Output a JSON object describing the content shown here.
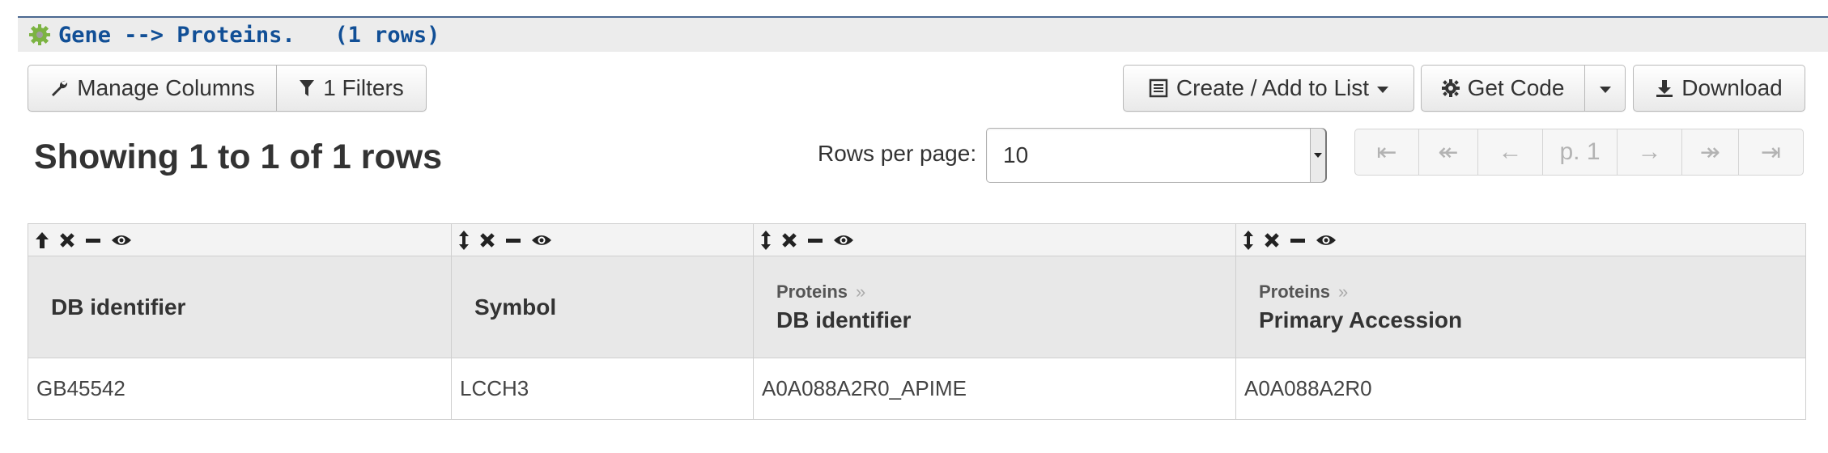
{
  "header": {
    "title": "Gene --> Proteins.",
    "row_count": "(1 rows)"
  },
  "toolbar": {
    "manage_columns": "Manage Columns",
    "filters": "1 Filters",
    "create_list": "Create / Add to List",
    "get_code": "Get Code",
    "download": "Download"
  },
  "summary": {
    "showing": "Showing 1 to 1 of 1 rows"
  },
  "pagination": {
    "rows_per_page_label": "Rows per page:",
    "rows_per_page_value": "10",
    "first": "⇤",
    "prev_many": "↞",
    "prev": "←",
    "page": "p. 1",
    "next": "→",
    "next_many": "↠",
    "last": "⇥"
  },
  "table": {
    "columns": [
      {
        "path": "",
        "name": "DB identifier"
      },
      {
        "path": "",
        "name": "Symbol"
      },
      {
        "path": "Proteins",
        "name": "DB identifier"
      },
      {
        "path": "Proteins",
        "name": "Primary Accession"
      }
    ],
    "rows": [
      [
        "GB45542",
        "LCCH3",
        "A0A088A2R0_APIME",
        "A0A088A2R0"
      ]
    ],
    "raquo": "»"
  },
  "colors": {
    "title": "#114f96",
    "accent_line": "#4b6991",
    "header_bg": "#e8e8e8"
  }
}
